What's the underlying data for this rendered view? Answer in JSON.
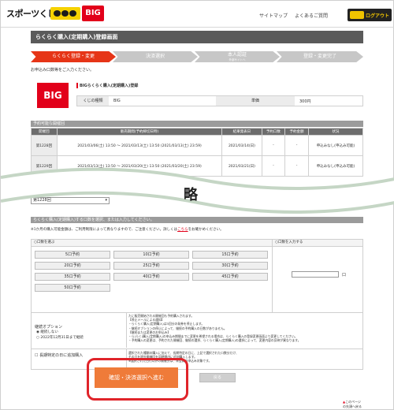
{
  "header": {
    "logo_text": "スポーツくじ",
    "big_logo": "BIG",
    "links": [
      "サイトマップ",
      "よくあるご質問"
    ],
    "logout": "ログアウト"
  },
  "page_title": "らくらく購入(定期購入)登録画面",
  "steps": [
    {
      "label": "らくらく登録・変更",
      "active": true
    },
    {
      "label": "決済選択",
      "active": false
    },
    {
      "label": "本人認証",
      "sub": "外部サイトへ",
      "active": false
    },
    {
      "label": "登録・変更完了",
      "active": false
    }
  ],
  "intro_note": "お申込み口数等をご入力ください。",
  "product": {
    "section": "BIGらくらく購入(定期購入)登録",
    "lottery_type_label": "くじの種類",
    "lottery_type": "BIG",
    "price_label": "単価",
    "price": "300円",
    "logo": "BIG"
  },
  "schedule": {
    "section": "予約可能な開催回",
    "headers": [
      "開催回",
      "販売期間(予約締切日時)",
      "結果発表日",
      "予約口数",
      "予約金額",
      "状況"
    ],
    "rows": [
      {
        "round": "第1228回",
        "period": "2021/03/06(土) 13:50 〜 2021/03/13(土) 13:50 (2021/03/13(土) 23:59)",
        "result": "2021/03/14(日)",
        "units": "-",
        "amount": "-",
        "status": "申込みなし(申込み可能)"
      },
      {
        "round": "第1229回",
        "period": "2021/03/13(土) 13:50 〜 2021/03/20(土) 13:50 (2021/03/20(土) 23:59)",
        "result": "2021/03/21(日)",
        "units": "-",
        "amount": "-",
        "status": "申込みなし(申込み可能)"
      }
    ]
  },
  "omitted_label": "略",
  "round_select": "第1228回",
  "units_section": {
    "title": "らくらく購入(定期購入)する口数を選択、または入力してください。",
    "note_pre": "※1か月の購入可能金額は、ご利用制限によって異なりますので、ご注意ください。詳しくは",
    "note_link": "こちら",
    "note_post": "をお確かめください。",
    "choose_label": "口数を選ぶ",
    "input_label": "口数を入力する",
    "options": [
      "5口予約",
      "10口予約",
      "15口予約",
      "20口予約",
      "25口予約",
      "30口予約",
      "35口予約",
      "40口予約",
      "45口予約",
      "50口予約"
    ],
    "unit_suffix": "口"
  },
  "continuation": {
    "label": "継続オプション",
    "options": [
      "継続しない",
      "2022年12月31日まで継続"
    ],
    "info_lines": [
      "たに販売開始される開催回も予約購入されます。",
      "【停止メールによる通知】",
      "・らくらく購入(定期購入)は3回分の発券を停止します。",
      "・継続オプションの停止によって、継続の予約購入の日数がありません。",
      "【継続または変更のお申込み】",
      "・ら(らく)購入(定期購入)の申込み期間までに変更を希望される場合は、らくらく購入の登録変更画面より変更してください。",
      "・予約購入の変更は、予約された開催回、継続の選択、らくらく購入(定期購入)の選択によって、変更内容の反映が異なります。"
    ]
  },
  "holiday": {
    "label": "長期特定の日に追加購入",
    "info_lines": [
      "選択された種類の購入に加えて、長期特定の日に、上記で選択された口数分だけ、",
      "その日を除外開催回を同時間内に追加購入します。",
      "※選択された日付以外の開催分は、未登録の申込み対象です。"
    ]
  },
  "buttons": {
    "confirm": "確認・決済選択へ進む",
    "back": "戻る"
  },
  "footer_link": "このページの先頭へ戻る"
}
